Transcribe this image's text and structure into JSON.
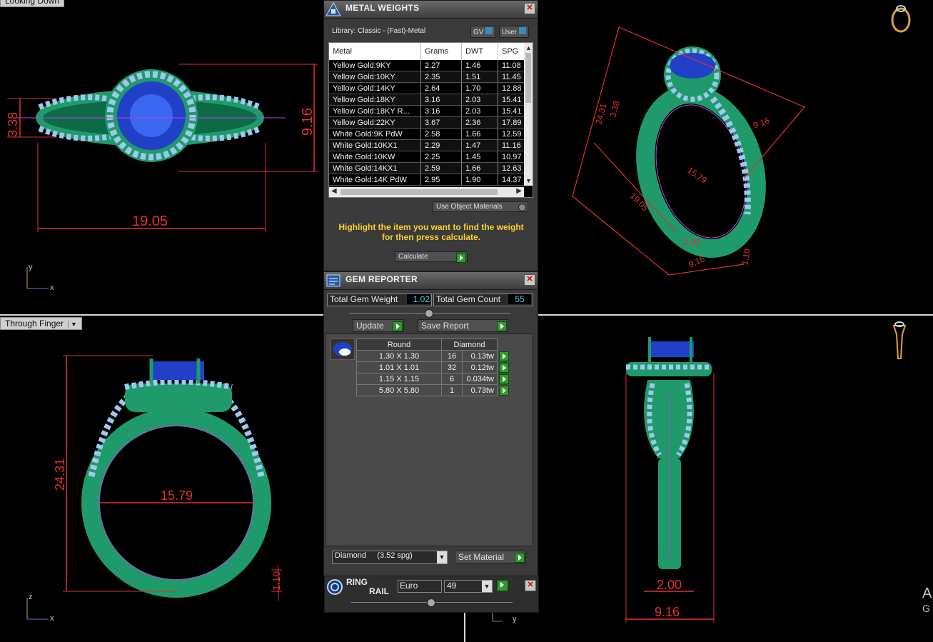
{
  "viewports": {
    "top_left": {
      "label_partial": "Looking Down",
      "dims": {
        "length": "19.05",
        "height": "9.16",
        "band": "3.38"
      },
      "axes": [
        "y",
        "x"
      ]
    },
    "top_right": {
      "dims": {
        "a": "24.31",
        "b": "9.16",
        "c": "15.79",
        "d": "19.05",
        "e": "2.00",
        "f": "9.16",
        "g": "1.10",
        "h": "3.38"
      }
    },
    "bottom_left": {
      "label": "Through Finger",
      "dims": {
        "height": "24.31",
        "inner": "15.79",
        "shank": "1.10"
      },
      "axes": [
        "z",
        "x"
      ]
    },
    "bottom_right": {
      "dims": {
        "shank": "2.00",
        "width": "9.16"
      },
      "axes": [
        "y"
      ],
      "edge_text": [
        "A",
        "G"
      ]
    }
  },
  "metal_weights": {
    "title": "METAL WEIGHTS",
    "library": "Library: Classic - (Fast)-Metal",
    "gv_label": "GV",
    "user_label": "User",
    "columns": [
      "Metal",
      "Grams",
      "DWT",
      "SPG"
    ],
    "rows": [
      [
        "Yellow Gold:9KY",
        "2.27",
        "1.46",
        "11.08"
      ],
      [
        "Yellow Gold:10KY",
        "2.35",
        "1.51",
        "11.45"
      ],
      [
        "Yellow Gold:14KY",
        "2.64",
        "1.70",
        "12.88"
      ],
      [
        "Yellow Gold:18KY",
        "3.16",
        "2.03",
        "15.41"
      ],
      [
        "Yellow Gold:18KY R...",
        "3.16",
        "2.03",
        "15.41"
      ],
      [
        "Yellow Gold:22KY",
        "3.67",
        "2.36",
        "17.89"
      ],
      [
        "White Gold:9K PdW",
        "2.58",
        "1.66",
        "12.59"
      ],
      [
        "White Gold:10KX1",
        "2.29",
        "1.47",
        "11.16"
      ],
      [
        "White Gold:10KW",
        "2.25",
        "1.45",
        "10.97"
      ],
      [
        "White Gold:14KX1",
        "2.59",
        "1.66",
        "12.63"
      ],
      [
        "White Gold:14K PdW",
        "2.95",
        "1.90",
        "14.37"
      ]
    ],
    "use_object_materials": "Use Object Materials",
    "highlight_text": "Highlight the item you want to find the weight for then press calculate.",
    "calculate": "Calculate"
  },
  "gem_reporter": {
    "title": "GEM REPORTER",
    "total_weight_label": "Total Gem Weight",
    "total_weight": "1.02",
    "total_count_label": "Total Gem Count",
    "total_count": "55",
    "update": "Update",
    "save_report": "Save Report",
    "shape": "Round",
    "material": "Diamond",
    "rows": [
      [
        "1.30 X 1.30",
        "16",
        "0.13tw"
      ],
      [
        "1.01 X 1.01",
        "32",
        "0.12tw"
      ],
      [
        "1.15 X 1.15",
        "6",
        "0.034tw"
      ],
      [
        "5.80 X 5.80",
        "1",
        "0.73tw"
      ]
    ],
    "material_select": "Diamond     (3.52 spg)",
    "set_material": "Set Material"
  },
  "ring_rail": {
    "title_1": "RING",
    "title_2": "RAIL",
    "standard": "Euro",
    "size": "49"
  },
  "colors": {
    "metal": "#1f9a6a",
    "stone": "#2040c8",
    "accent_gem": "#9ec8f0",
    "dimension": "#e23030",
    "highlight": "#ffcf2e"
  }
}
